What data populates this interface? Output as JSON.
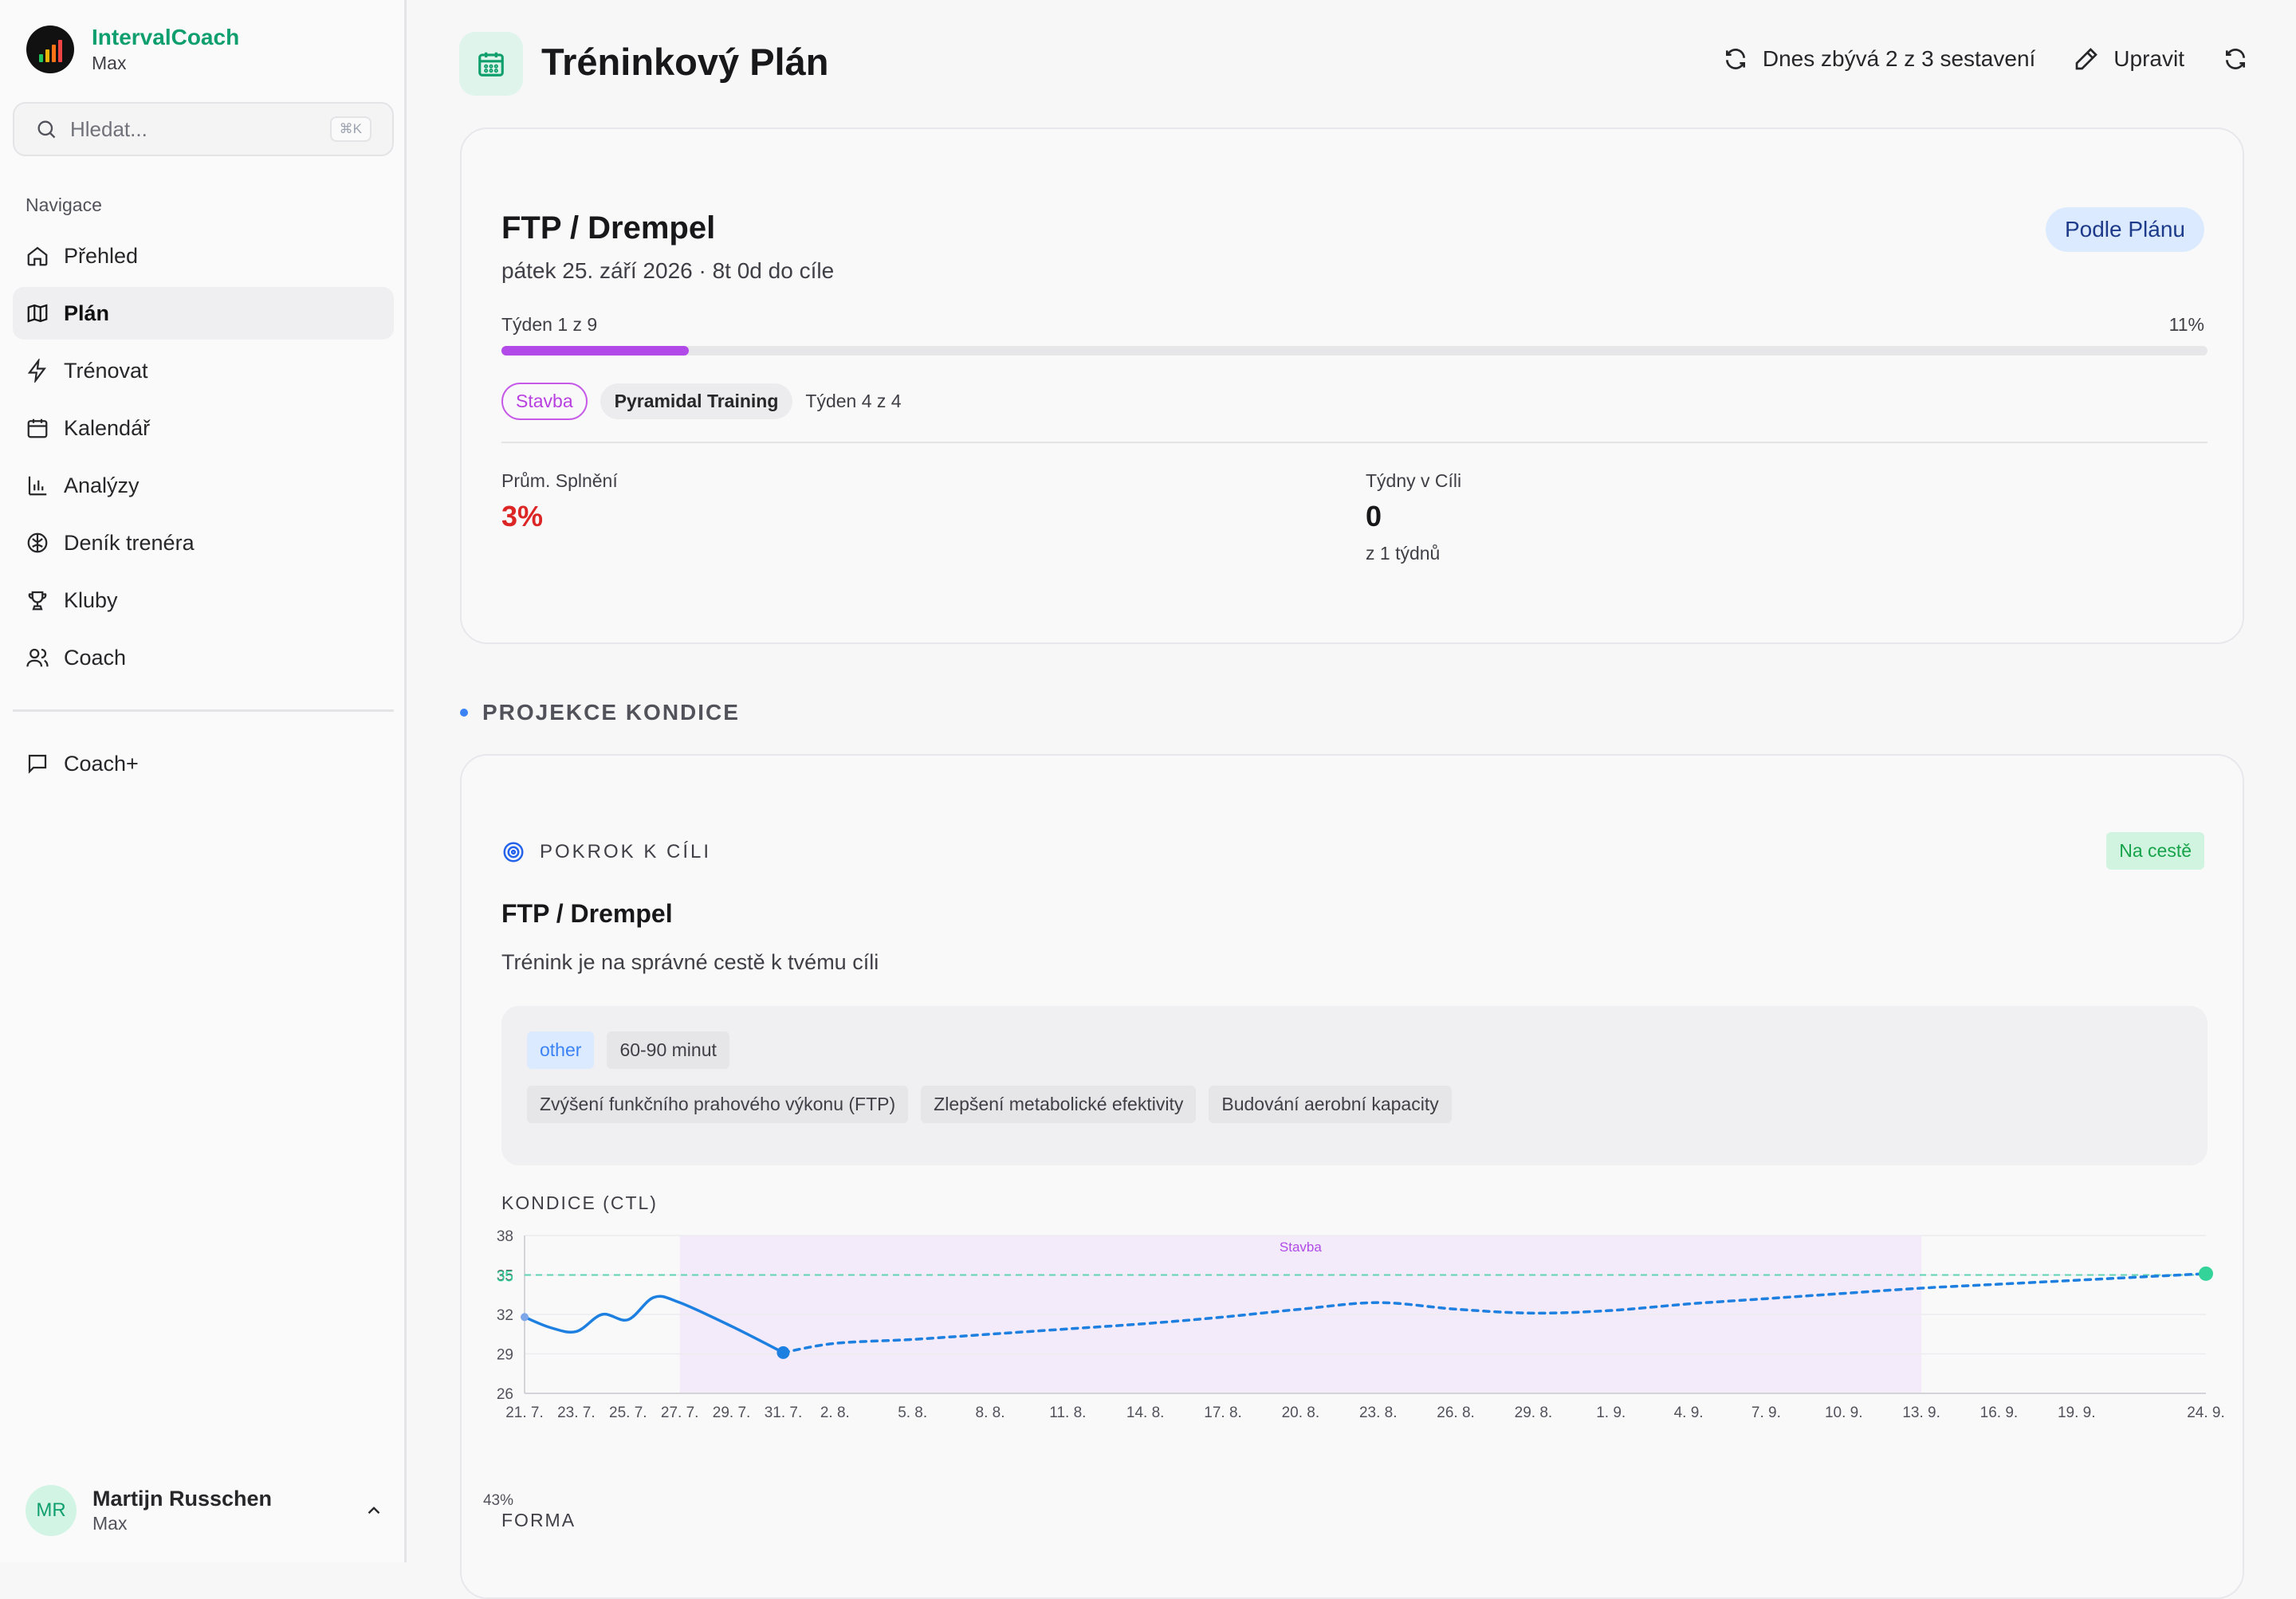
{
  "app": {
    "name": "IntervalCoach",
    "plan": "Max"
  },
  "search": {
    "placeholder": "Hledat...",
    "shortcut": "⌘K"
  },
  "sidebar": {
    "nav_heading": "Navigace",
    "items": [
      {
        "label": "Přehled",
        "icon": "home-icon"
      },
      {
        "label": "Plán",
        "icon": "map-icon",
        "active": true
      },
      {
        "label": "Trénovat",
        "icon": "zap-icon"
      },
      {
        "label": "Kalendář",
        "icon": "calendar-icon"
      },
      {
        "label": "Analýzy",
        "icon": "bar-chart-icon"
      },
      {
        "label": "Deník trenéra",
        "icon": "brain-icon"
      },
      {
        "label": "Kluby",
        "icon": "trophy-icon"
      },
      {
        "label": "Coach",
        "icon": "users-icon"
      }
    ],
    "coach_plus": "Coach+"
  },
  "user": {
    "initials": "MR",
    "name": "Martijn Russchen",
    "plan": "Max"
  },
  "header": {
    "title": "Tréninkový Plán",
    "regen_label": "Dnes zbývá 2 z 3 sestavení",
    "edit_label": "Upravit"
  },
  "goal": {
    "title": "FTP / Drempel",
    "date": "pátek 25. září 2026 · 8t 0d do cíle",
    "badge": "Podle Plánu",
    "week_label": "Týden 1 z 9",
    "progress_label": "11%",
    "progress": 0.11,
    "phase_chip": "Stavba",
    "block_chip": "Pyramidal Training",
    "block_week": "Týden 4 z 4",
    "stats": {
      "completion_label": "Prům. Splnění",
      "completion_value": "3%",
      "weeks_label": "Týdny v Cíli",
      "weeks_value": "0",
      "weeks_sub": "z 1 týdnů"
    }
  },
  "projection": {
    "section_title": "PROJEKCE KONDICE",
    "card_head": "POKROK K CÍLI",
    "status": "Na cestě",
    "title": "FTP / Drempel",
    "description": "Trénink je na správné cestě k tvému cíli",
    "tags_row1": [
      "other",
      "60-90 minut"
    ],
    "tags_row2": [
      "Zvýšení funkčního prahového výkonu (FTP)",
      "Zlepšení metabolické efektivity",
      "Budování aerobní kapacity"
    ],
    "chart_label": "KONDICE (CTL)",
    "forma_label": "FORMA",
    "forma_first_tick": "43%"
  },
  "colors": {
    "accent": "#0f9f6e",
    "actual": "#1d7fe0",
    "target": "#34d399",
    "phase": "#b14ae8"
  },
  "chart_data": {
    "type": "line",
    "title": "KONDICE (CTL)",
    "ylim": [
      26,
      38
    ],
    "yticks": [
      38,
      35,
      32,
      29,
      26
    ],
    "target": 35,
    "target_label": "35",
    "phase_band": {
      "label": "Stavba",
      "from": "27. 7.",
      "to": "13. 9."
    },
    "xticks": [
      "21. 7.",
      "23. 7.",
      "25. 7.",
      "27. 7.",
      "29. 7.",
      "31. 7.",
      "2. 8.",
      "5. 8.",
      "8. 8.",
      "11. 8.",
      "14. 8.",
      "17. 8.",
      "20. 8.",
      "23. 8.",
      "26. 8.",
      "29. 8.",
      "1. 9.",
      "4. 9.",
      "7. 9.",
      "10. 9.",
      "13. 9.",
      "16. 9.",
      "19. 9.",
      "24. 9."
    ],
    "series": [
      {
        "style": "solid",
        "x": [
          "21. 7.",
          "22. 7.",
          "23. 7.",
          "24. 7.",
          "25. 7.",
          "26. 7.",
          "27. 7.",
          "29. 7.",
          "31. 7."
        ],
        "values": [
          31.8,
          31.0,
          30.7,
          32.0,
          31.6,
          33.3,
          32.9,
          31.1,
          29.1
        ]
      },
      {
        "style": "dashed",
        "x": [
          "31. 7.",
          "2. 8.",
          "5. 8.",
          "8. 8.",
          "11. 8.",
          "14. 8.",
          "17. 8.",
          "20. 8.",
          "23. 8.",
          "26. 8.",
          "29. 8.",
          "1. 9.",
          "4. 9.",
          "7. 9.",
          "10. 9.",
          "13. 9.",
          "16. 9.",
          "19. 9.",
          "24. 9."
        ],
        "values": [
          29.1,
          29.8,
          30.1,
          30.5,
          30.9,
          31.3,
          31.8,
          32.4,
          32.9,
          32.4,
          32.1,
          32.3,
          32.8,
          33.2,
          33.6,
          34.0,
          34.3,
          34.6,
          35.1
        ]
      }
    ]
  }
}
